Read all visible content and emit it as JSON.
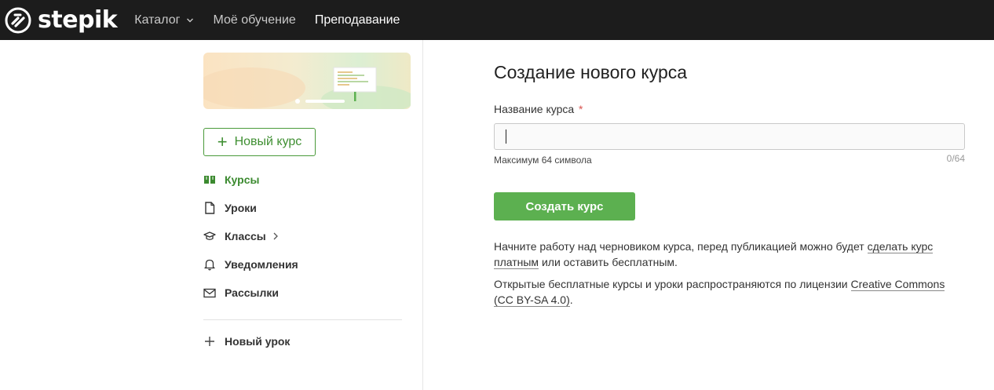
{
  "header": {
    "logo_text": "stepik",
    "nav": [
      {
        "label": "Каталог",
        "has_dropdown": true
      },
      {
        "label": "Моё обучение"
      },
      {
        "label": "Преподавание",
        "active": true
      }
    ]
  },
  "sidebar": {
    "new_course_label": "Новый курс",
    "items": [
      {
        "label": "Курсы",
        "icon": "book-icon",
        "active": true
      },
      {
        "label": "Уроки",
        "icon": "document-icon"
      },
      {
        "label": "Классы",
        "icon": "graduation-cap-icon",
        "has_submenu": true
      },
      {
        "label": "Уведомления",
        "icon": "bell-icon"
      },
      {
        "label": "Рассылки",
        "icon": "mail-icon"
      }
    ],
    "new_lesson_label": "Новый урок"
  },
  "main": {
    "title": "Создание нового курса",
    "field_label": "Название курса",
    "required_mark": "*",
    "input_value": "",
    "hint": "Максимум 64 символа",
    "counter": "0/64",
    "submit_label": "Создать курс",
    "paragraph1": {
      "before": "Начните работу над черновиком курса, перед публикацией можно будет ",
      "link": "сделать курс платным",
      "after": " или оставить бесплатным."
    },
    "paragraph2": {
      "before": "Открытые бесплатные курсы и уроки распространяются по лицензии ",
      "link": "Creative Commons (CC BY-SA 4.0)",
      "after": "."
    }
  },
  "colors": {
    "topbar": "#1c1c1c",
    "accent_green": "#5cb050",
    "active_green": "#3b8a2f",
    "required_red": "#d9534f"
  }
}
